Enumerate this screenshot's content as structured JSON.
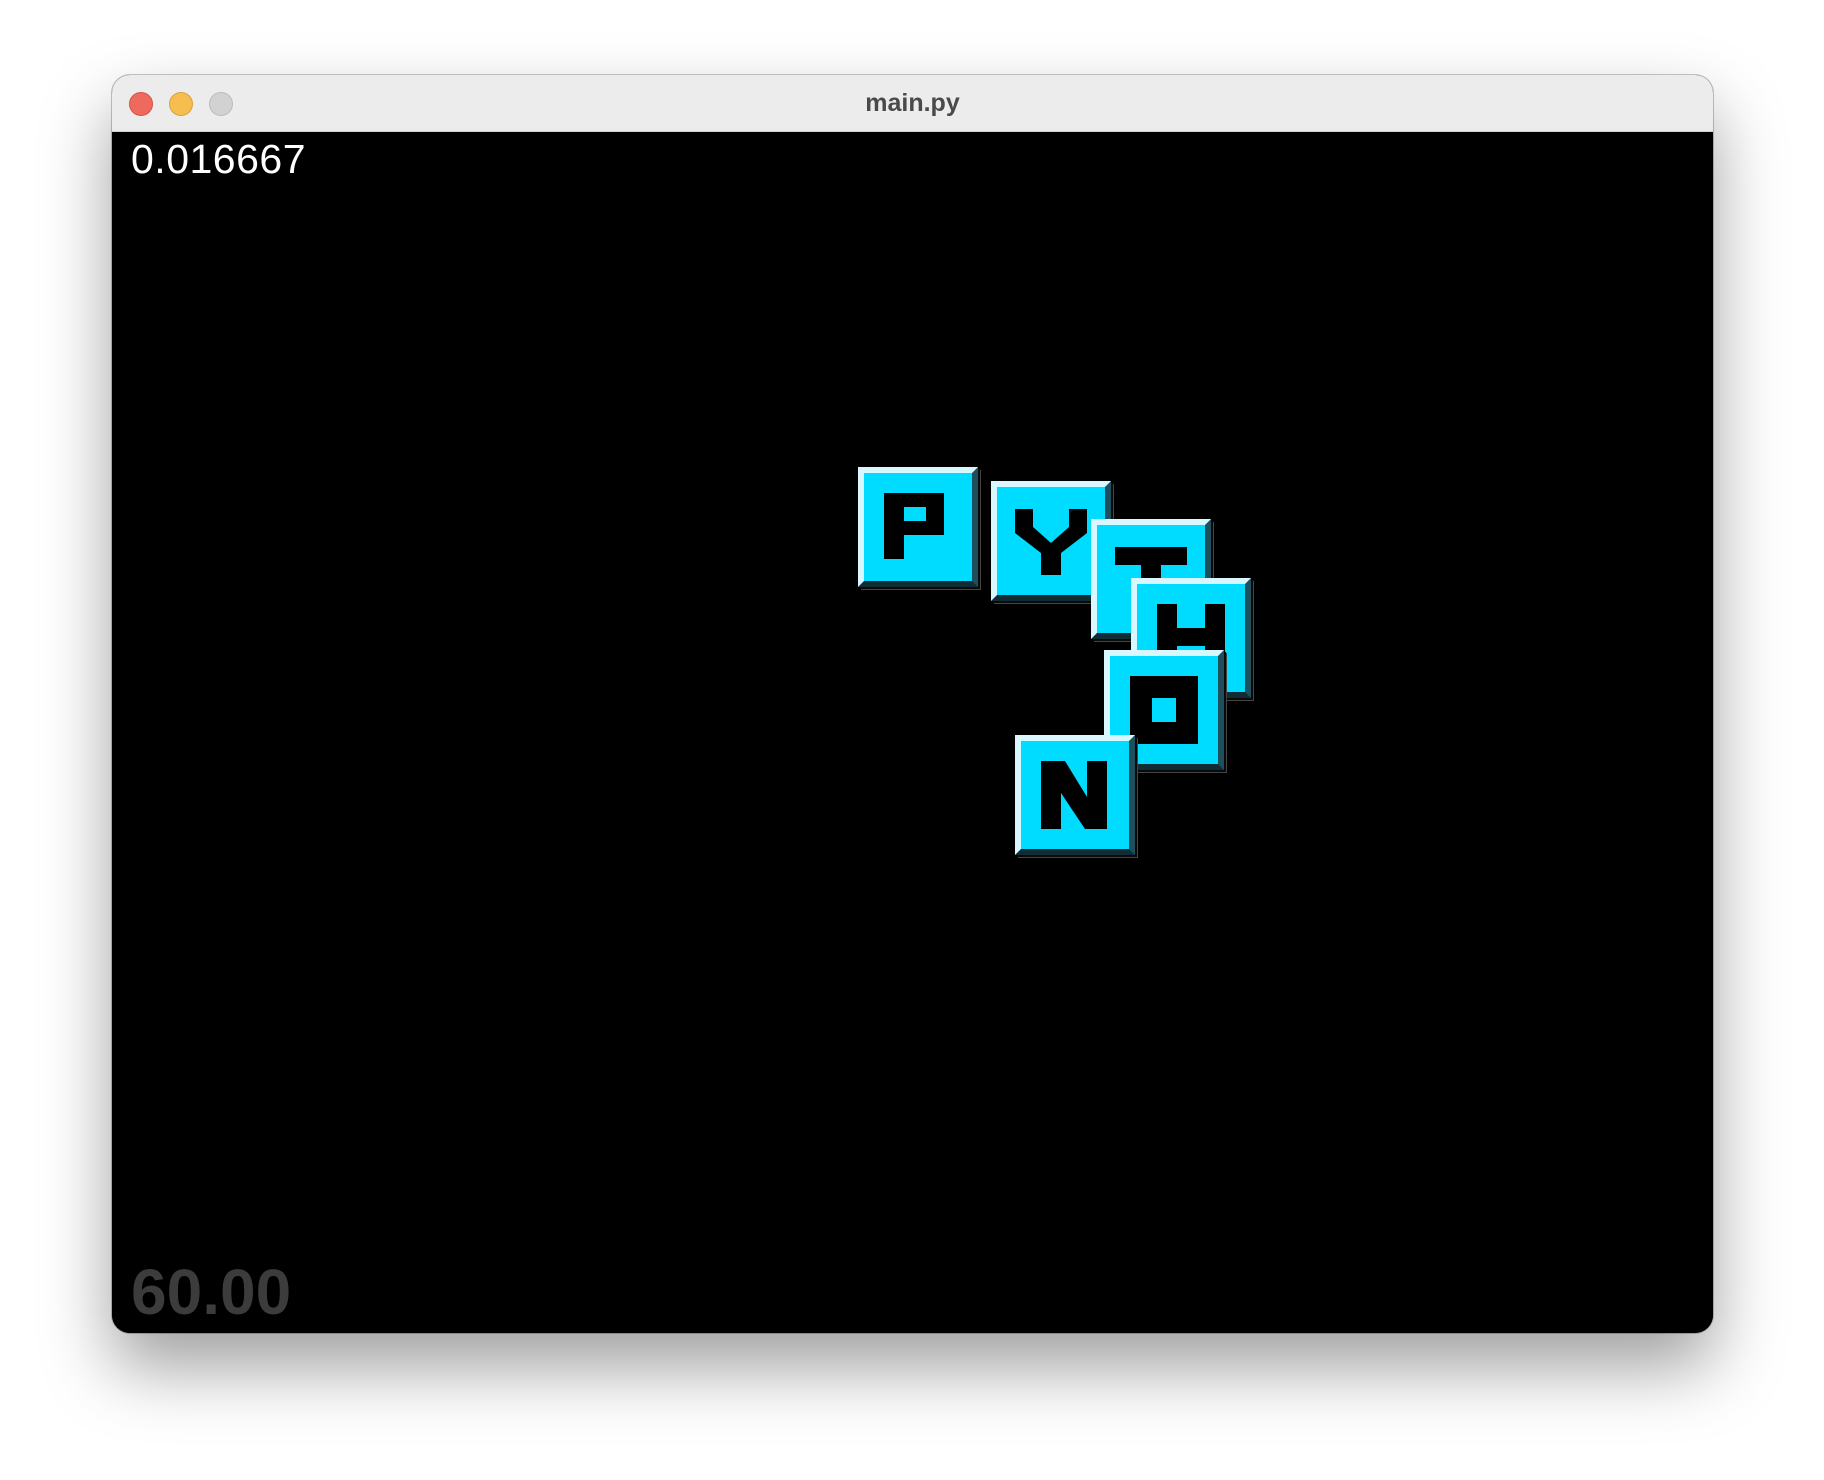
{
  "window": {
    "title": "main.py"
  },
  "hud": {
    "timer": "0.016667",
    "fps": "60.00"
  },
  "tiles": [
    {
      "letter": "P"
    },
    {
      "letter": "Y"
    },
    {
      "letter": "T"
    },
    {
      "letter": "H"
    },
    {
      "letter": "O"
    },
    {
      "letter": "N"
    }
  ],
  "colors": {
    "tile_fill": "#00dcff",
    "background": "#000000",
    "timer_text": "#ffffff",
    "fps_text": "#3c3c3c"
  }
}
